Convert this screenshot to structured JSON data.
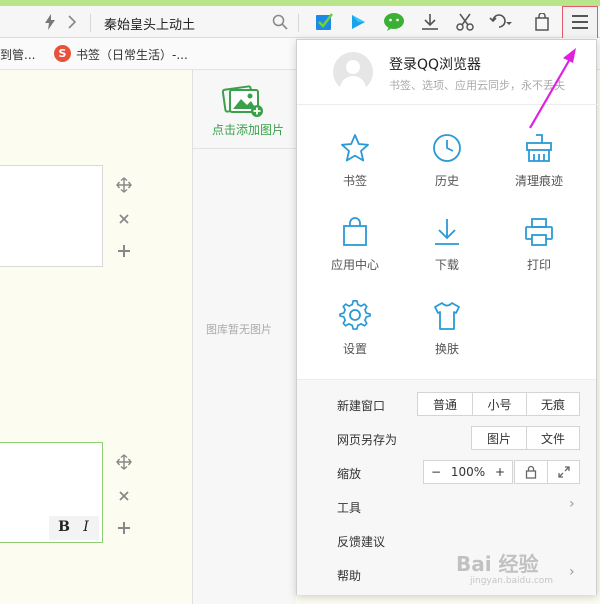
{
  "toolbar": {
    "address_text": "秦始皇头上动土",
    "icons": [
      "lightning-icon",
      "chevron-right-icon",
      "search-icon",
      "checklist-icon",
      "video-play-icon",
      "wechat-icon",
      "download-icon",
      "scissors-icon",
      "undo-icon",
      "bag-icon",
      "menu-icon"
    ]
  },
  "bookmarks": {
    "items": [
      {
        "label": "到管..."
      },
      {
        "label": "书签（日常生活）-..."
      }
    ]
  },
  "image_panel": {
    "add_label": "点击添加图片",
    "empty_label": "图库暂无图片"
  },
  "editor": {
    "bold_label": "B",
    "italic_label": "I"
  },
  "menu": {
    "login_title": "登录QQ浏览器",
    "login_subtitle": "书签、选项、应用云同步，永不丢失",
    "grid": [
      {
        "label": "书签",
        "icon": "star-icon"
      },
      {
        "label": "历史",
        "icon": "clock-icon"
      },
      {
        "label": "清理痕迹",
        "icon": "broom-icon"
      },
      {
        "label": "应用中心",
        "icon": "shopping-bag-icon"
      },
      {
        "label": "下载",
        "icon": "download-icon"
      },
      {
        "label": "打印",
        "icon": "printer-icon"
      },
      {
        "label": "设置",
        "icon": "gear-icon"
      },
      {
        "label": "换肤",
        "icon": "tshirt-icon"
      }
    ],
    "new_window": {
      "label": "新建窗口",
      "options": [
        "普通",
        "小号",
        "无痕"
      ]
    },
    "save_as": {
      "label": "网页另存为",
      "options": [
        "图片",
        "文件"
      ]
    },
    "zoom": {
      "label": "缩放",
      "minus": "−",
      "value": "100%",
      "plus": "+"
    },
    "tools_label": "工具",
    "feedback_label": "反馈建议",
    "help_label": "帮助"
  },
  "watermark": {
    "brand": "Bai 经验",
    "url": "jingyan.baidu.com"
  },
  "colors": {
    "accent_blue": "#2a9ad6",
    "accent_green": "#3aa04a",
    "annotation_magenta": "#e020e0"
  }
}
